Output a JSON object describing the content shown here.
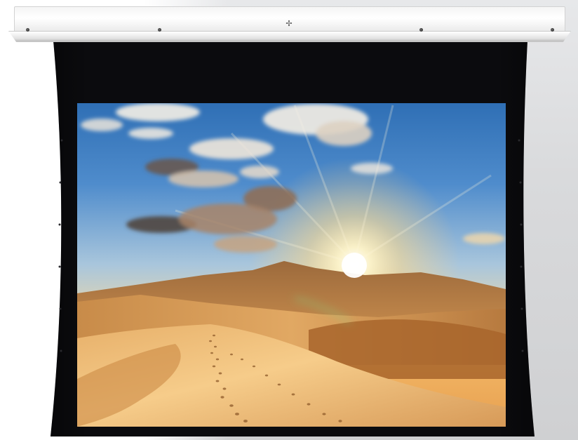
{
  "scene": {
    "subject": "ceiling-recessed-projector-screen",
    "colors": {
      "wall": "#d9dadc",
      "housing": "#f2f2f2",
      "screen_border": "#0a0a0c",
      "sky_top": "#3c80c4",
      "sky_horizon": "#f2c88a",
      "sun": "#fff6d6",
      "sand_light": "#f2c27a",
      "sand_shadow": "#b86d2f"
    },
    "icons": [
      "screw-icon",
      "bracket-icon"
    ]
  }
}
